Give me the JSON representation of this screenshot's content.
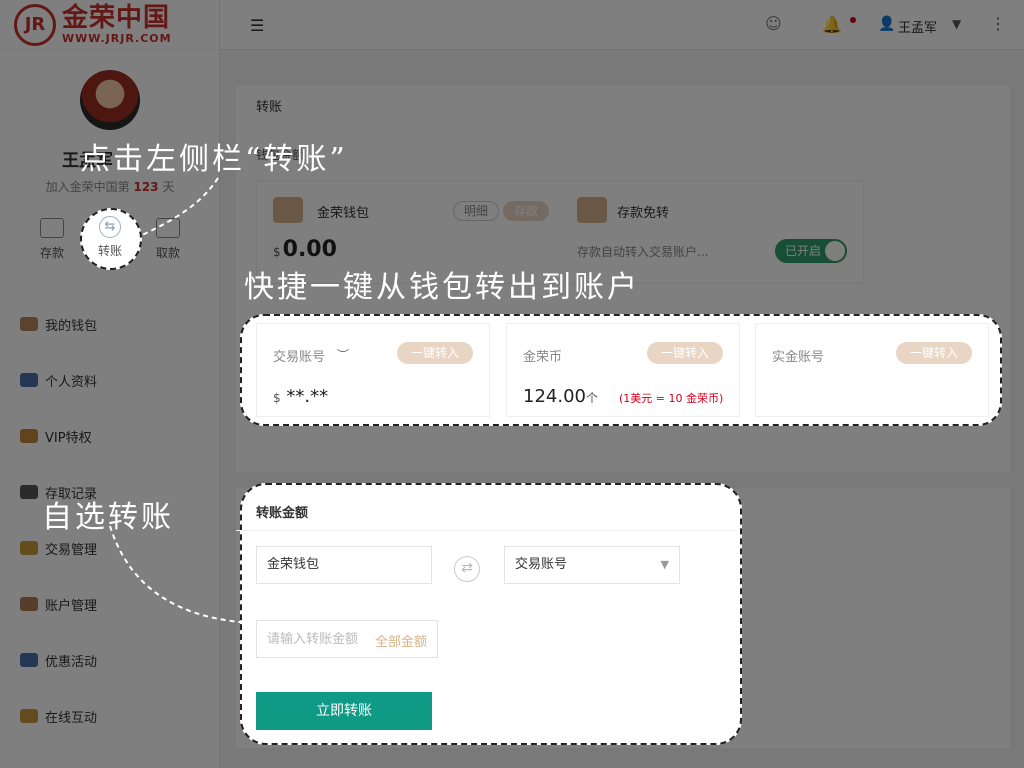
{
  "logo": {
    "mark": "JR",
    "cn": "金荣中国",
    "url": "WWW.JRJR.COM"
  },
  "user": {
    "name": "王孟军",
    "join_prefix": "加入金荣中国第",
    "days": "123",
    "join_suffix": "天"
  },
  "quick_actions": {
    "deposit": "存款",
    "transfer": "转账",
    "withdraw": "取款"
  },
  "menu": [
    {
      "label": "我的钱包",
      "color": "#b9875a"
    },
    {
      "label": "个人资料",
      "color": "#4a6fa5"
    },
    {
      "label": "VIP特权",
      "color": "#c0883c"
    },
    {
      "label": "存取记录",
      "color": "#555555"
    },
    {
      "label": "交易管理",
      "color": "#c89a3a"
    },
    {
      "label": "账户管理",
      "color": "#b07a5a"
    },
    {
      "label": "优惠活动",
      "color": "#4a6fa5"
    },
    {
      "label": "在线互动",
      "color": "#c8963a"
    }
  ],
  "header": {
    "hamburger": "☰",
    "support": "☺",
    "bell": "🔔",
    "user_icon": "👤",
    "username": "王孟军",
    "caret": "▼",
    "more": "⋮"
  },
  "transfer_page": {
    "title": "转账",
    "wallet_section": "钱包金额",
    "wallet": {
      "label": "金荣钱包",
      "details": "明细",
      "deposit": "存款",
      "currency": "$",
      "amount": "0.00"
    },
    "auto": {
      "label": "存款免转",
      "desc": "存款自动转入交易账户...",
      "toggle": "已开启"
    },
    "accounts": [
      {
        "label": "交易账号",
        "button": "一键转入",
        "currency": "$",
        "value": "**.**"
      },
      {
        "label": "金荣币",
        "button": "一键转入",
        "value": "124.00",
        "unit": "个",
        "note": "(1美元 = 10 金荣币)"
      },
      {
        "label": "实金账号",
        "button": "一键转入"
      }
    ]
  },
  "transfer_form": {
    "title": "转账金额",
    "from": "金荣钱包",
    "to": "交易账号",
    "amount_placeholder": "请输入转账金额",
    "all_amount": "全部金额",
    "submit": "立即转账"
  },
  "captions": {
    "sidebar": "点击左侧栏“转账”",
    "oneclick": "快捷一键从钱包转出到账户",
    "custom": "自选转账"
  },
  "colors": {
    "brand": "#c8302a",
    "accent": "#0f9a85",
    "pill": "#e8d5c4",
    "toggle": "#2f9d6b"
  }
}
